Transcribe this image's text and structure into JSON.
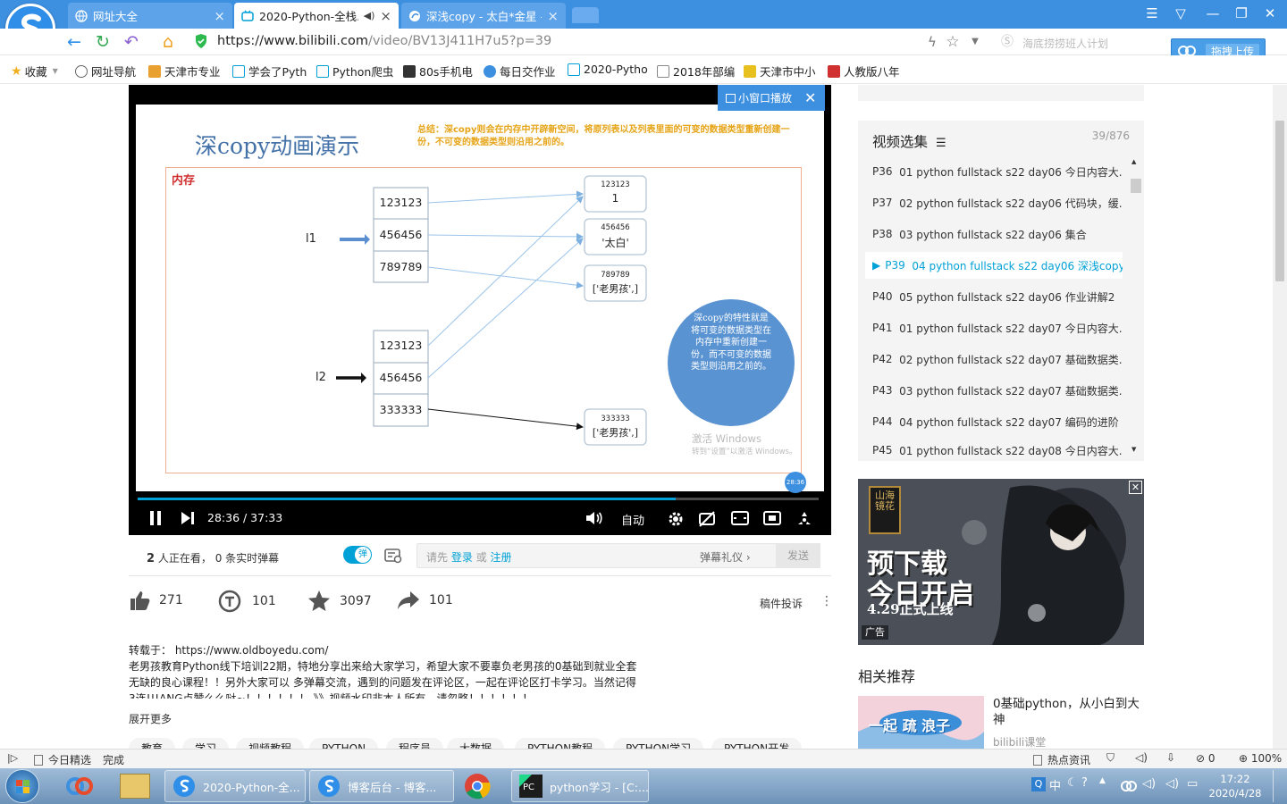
{
  "browser": {
    "tabs": [
      {
        "title": "网址大全"
      },
      {
        "title": "2020-Python-全栈..."
      },
      {
        "title": "深浅copy - 太白*金星 -"
      }
    ],
    "url_host": "https://www.bilibili.com",
    "url_path": "/video/BV13J411H7u5?p=39",
    "search_placeholder": "海底捞捞班人计划",
    "upload_button": "拖拽上传"
  },
  "bookmarks": [
    {
      "label": "收藏"
    },
    {
      "label": "网址导航"
    },
    {
      "label": "天津市专业"
    },
    {
      "label": "学会了Pyth"
    },
    {
      "label": "Python爬虫"
    },
    {
      "label": "80s手机电"
    },
    {
      "label": "每日交作业"
    },
    {
      "label": "2020-Pytho"
    },
    {
      "label": "2018年部编"
    },
    {
      "label": "天津市中小"
    },
    {
      "label": "人教版八年"
    }
  ],
  "slide": {
    "title": "深copy动画演示",
    "summary": "总结：深copy则会在内存中开辟新空间，将原列表以及列表里面的可变的数据类型重新创建一份，不可变的数据类型则沿用之前的。",
    "memory_label": "内存",
    "l1_label": "l1",
    "l2_label": "l2",
    "l1_cells": [
      "123123",
      "456456",
      "789789"
    ],
    "l2_cells": [
      "123123",
      "456456",
      "333333"
    ],
    "objects": [
      {
        "id": "123123",
        "value": "1"
      },
      {
        "id": "456456",
        "value": "'太白'"
      },
      {
        "id": "789789",
        "value": "['老男孩',]"
      },
      {
        "id": "333333",
        "value": "['老男孩',]"
      }
    ],
    "note": "深copy的特性就是将可变的数据类型在内存中重新创建一份，而不可变的数据类型则沿用之前的。",
    "watermark_line1": "激活 Windows",
    "watermark_line2": "转到“设置”以激活 Windows。",
    "timestamp_badge": "28:36"
  },
  "player": {
    "mini_window": "小窗口播放",
    "time": "28:36 / 37:33",
    "progress": 0.79,
    "quality": "自动",
    "viewers_count": "2",
    "viewers_text": "人正在看，",
    "danmaku_count": "0 条实时弹幕",
    "danmaku_toggle": "弹",
    "input_prefix": "请先",
    "login": "登录",
    "or": "或",
    "register": "注册",
    "etiquette": "弹幕礼仪",
    "send": "发送"
  },
  "stats": {
    "likes": "271",
    "coins": "101",
    "favorites": "3097",
    "shares": "101",
    "report": "稿件投诉"
  },
  "description": {
    "line1": "转载于： https://www.oldboyedu.com/",
    "line2": "老男孩教育Python线下培训22期，特地分享出来给大家学习，希望大家不要辜负老男孩的0基础到就业全套",
    "line3": "无缺的良心课程！！另外大家可以 多弹幕交流，遇到的问题发在评论区，一起在评论区打卡学习。当然记得",
    "line4": "3连!!!ANG点赞么么哒~！！！！！！ 》》视频水印非本人所有，请忽略！！！！！！",
    "expand": "展开更多"
  },
  "tags": [
    "教育",
    "学习",
    "视频教程",
    "PYTHON",
    "程序员",
    "大数据",
    "PYTHON教程",
    "PYTHON学习",
    "PYTHON开发"
  ],
  "playlist": {
    "title": "视频选集",
    "count": "39/876",
    "items": [
      {
        "p": "P36",
        "title": "01 python fullstack s22 day06 今日内容大..."
      },
      {
        "p": "P37",
        "title": "02 python fullstack s22 day06 代码块，缓..."
      },
      {
        "p": "P38",
        "title": "03 python fullstack s22 day06 集合"
      },
      {
        "p": "P39",
        "title": "04 python fullstack s22 day06 深浅copy"
      },
      {
        "p": "P40",
        "title": "05 python fullstack s22 day06 作业讲解2"
      },
      {
        "p": "P41",
        "title": "01 python fullstack s22 day07 今日内容大..."
      },
      {
        "p": "P42",
        "title": "02 python fullstack s22 day07 基础数据类..."
      },
      {
        "p": "P43",
        "title": "03 python fullstack s22 day07 基础数据类..."
      },
      {
        "p": "P44",
        "title": "04 python fullstack s22 day07 编码的进阶"
      },
      {
        "p": "P45",
        "title": "01 python fullstack s22 day08 今日内容大..."
      }
    ]
  },
  "ad": {
    "logo_text": "山海镜花",
    "line1": "预下载",
    "line2": "今日开启",
    "line3": "4.29正式上线",
    "badge": "广告"
  },
  "related": {
    "heading": "相关推荐",
    "title": "0基础python，从小白到大神",
    "uploader": "bilibili课堂",
    "thumb_text": "一起 疏 浪子"
  },
  "statusbar": {
    "today": "今日精选",
    "done": "完成",
    "news": "热点资讯",
    "count": "0",
    "zoom": "100%"
  },
  "taskbar": {
    "items": [
      {
        "label": "2020-Python-全..."
      },
      {
        "label": "博客后台 - 博客..."
      },
      {
        "label": "python学习 - [C:..."
      }
    ],
    "ime": "中",
    "time": "17:22",
    "date": "2020/4/28"
  }
}
